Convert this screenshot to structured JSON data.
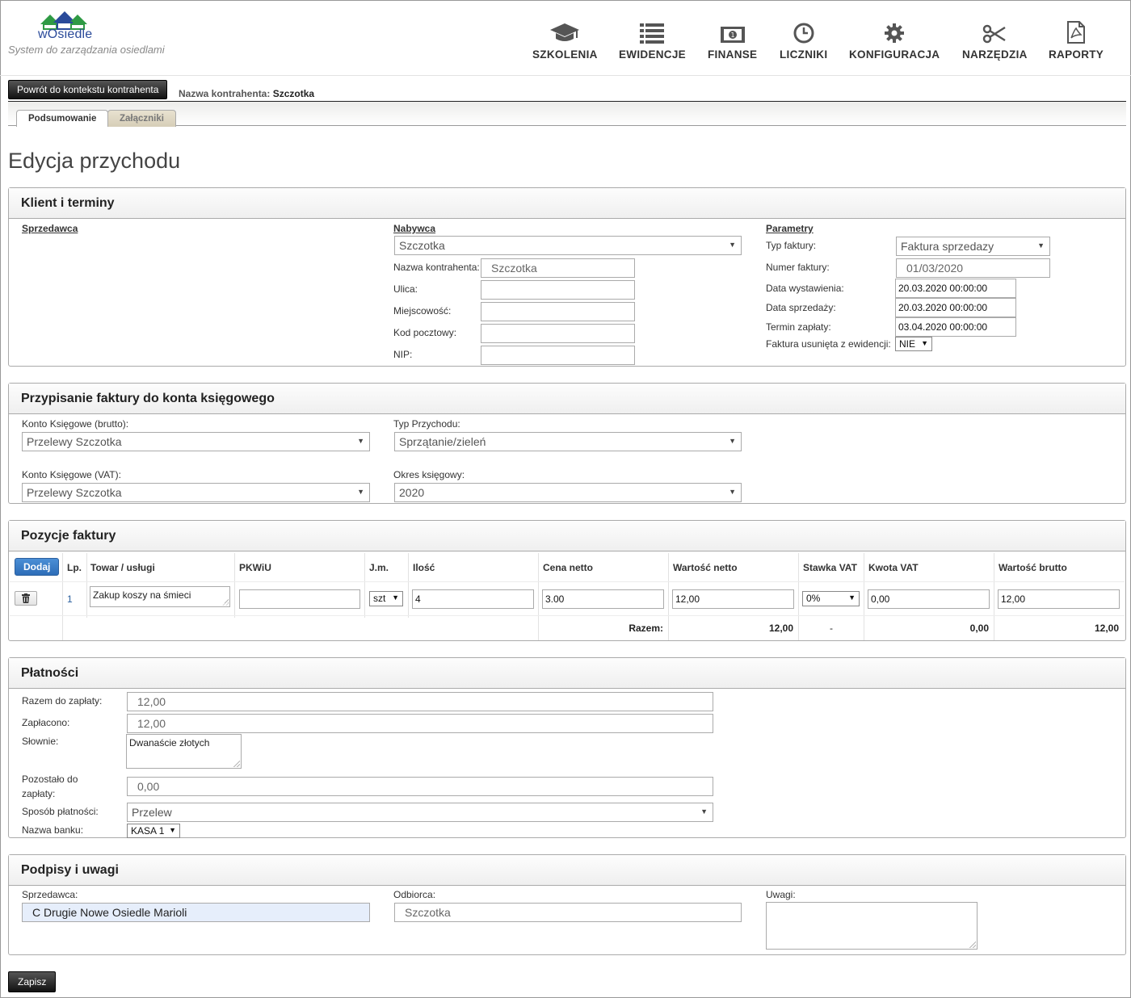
{
  "app": {
    "logo_text": "wOsiedle",
    "tagline": "System do zarządzania osiedlami"
  },
  "nav": [
    {
      "label": "SZKOLENIA",
      "icon": "graduation-cap-icon"
    },
    {
      "label": "EWIDENCJE",
      "icon": "list-icon"
    },
    {
      "label": "FINANSE",
      "icon": "money-icon"
    },
    {
      "label": "LICZNIKI",
      "icon": "clock-icon"
    },
    {
      "label": "KONFIGURACJA",
      "icon": "gear-icon"
    },
    {
      "label": "NARZĘDZIA",
      "icon": "scissors-icon"
    },
    {
      "label": "RAPORTY",
      "icon": "pdf-file-icon"
    }
  ],
  "context": {
    "back_button": "Powrót do kontekstu kontrahenta",
    "name_label": "Nazwa kontrahenta:",
    "name_value": "Szczotka"
  },
  "tabs": [
    {
      "label": "Podsumowanie",
      "active": true
    },
    {
      "label": "Załączniki",
      "active": false
    }
  ],
  "page_title": "Edycja przychodu",
  "client": {
    "title": "Klient i terminy",
    "seller_heading": "Sprzedawca",
    "buyer_heading": "Nabywca",
    "buyer_select": "Szczotka",
    "contractor_name_label": "Nazwa kontrahenta:",
    "contractor_name_value": "Szczotka",
    "street_label": "Ulica:",
    "city_label": "Miejscowość:",
    "postal_label": "Kod pocztowy:",
    "nip_label": "NIP:",
    "params_heading": "Parametry",
    "invoice_type_label": "Typ faktury:",
    "invoice_type_value": "Faktura sprzedazy",
    "invoice_number_label": "Numer faktury:",
    "invoice_number_value": "01/03/2020",
    "issue_date_label": "Data wystawienia:",
    "issue_date_value": "20.03.2020 00:00:00",
    "sale_date_label": "Data sprzedaży:",
    "sale_date_value": "20.03.2020 00:00:00",
    "due_date_label": "Termin zapłaty:",
    "due_date_value": "03.04.2020 00:00:00",
    "removed_label": "Faktura usunięta z ewidencji:",
    "removed_value": "NIE"
  },
  "accounting": {
    "title": "Przypisanie faktury do konta księgowego",
    "gross_label": "Konto Księgowe (brutto):",
    "gross_value": "Przelewy Szczotka",
    "income_type_label": "Typ Przychodu:",
    "income_type_value": "Sprzątanie/zieleń",
    "vat_label": "Konto Księgowe (VAT):",
    "vat_value": "Przelewy Szczotka",
    "period_label": "Okres księgowy:",
    "period_value": "2020"
  },
  "items": {
    "title": "Pozycje faktury",
    "add_button": "Dodaj",
    "headers": {
      "lp": "Lp.",
      "product": "Towar / usługi",
      "pkwiu": "PKWiU",
      "unit": "J.m.",
      "qty": "Ilość",
      "net_price": "Cena netto",
      "net_value": "Wartość netto",
      "vat_rate": "Stawka VAT",
      "vat_amount": "Kwota VAT",
      "gross_value": "Wartość brutto"
    },
    "rows": [
      {
        "lp": "1",
        "product": "Zakup koszy na śmieci",
        "pkwiu": "",
        "unit": "szt",
        "qty": "4",
        "net_price": "3.00",
        "net_value": "12,00",
        "vat_rate": "0%",
        "vat_amount": "0,00",
        "gross_value": "12,00"
      }
    ],
    "totals": {
      "label": "Razem:",
      "net_value": "12,00",
      "vat_rate": "-",
      "vat_amount": "0,00",
      "gross_value": "12,00"
    }
  },
  "payments": {
    "title": "Płatności",
    "total_label": "Razem do zapłaty:",
    "total_value": "12,00",
    "paid_label": "Zapłacono:",
    "paid_value": "12,00",
    "words_label": "Słownie:",
    "words_value": "Dwanaście złotych",
    "remaining_label_1": "Pozostało do",
    "remaining_label_2": "zapłaty:",
    "remaining_value": "0,00",
    "method_label": "Sposób płatności:",
    "method_value": "Przelew",
    "bank_label": "Nazwa banku:",
    "bank_value": "KASA 1"
  },
  "signatures": {
    "title": "Podpisy i uwagi",
    "seller_label": "Sprzedawca:",
    "seller_value": "C Drugie Nowe Osiedle Marioli",
    "recipient_label": "Odbiorca:",
    "recipient_value": "Szczotka",
    "notes_label": "Uwagi:",
    "notes_value": ""
  },
  "save_button": "Zapisz",
  "colors": {
    "accent_blue": "#2d6db8",
    "logo_blue": "#2a4a9a",
    "logo_green": "#3aa64a",
    "highlight_input": "#e6eefb"
  }
}
